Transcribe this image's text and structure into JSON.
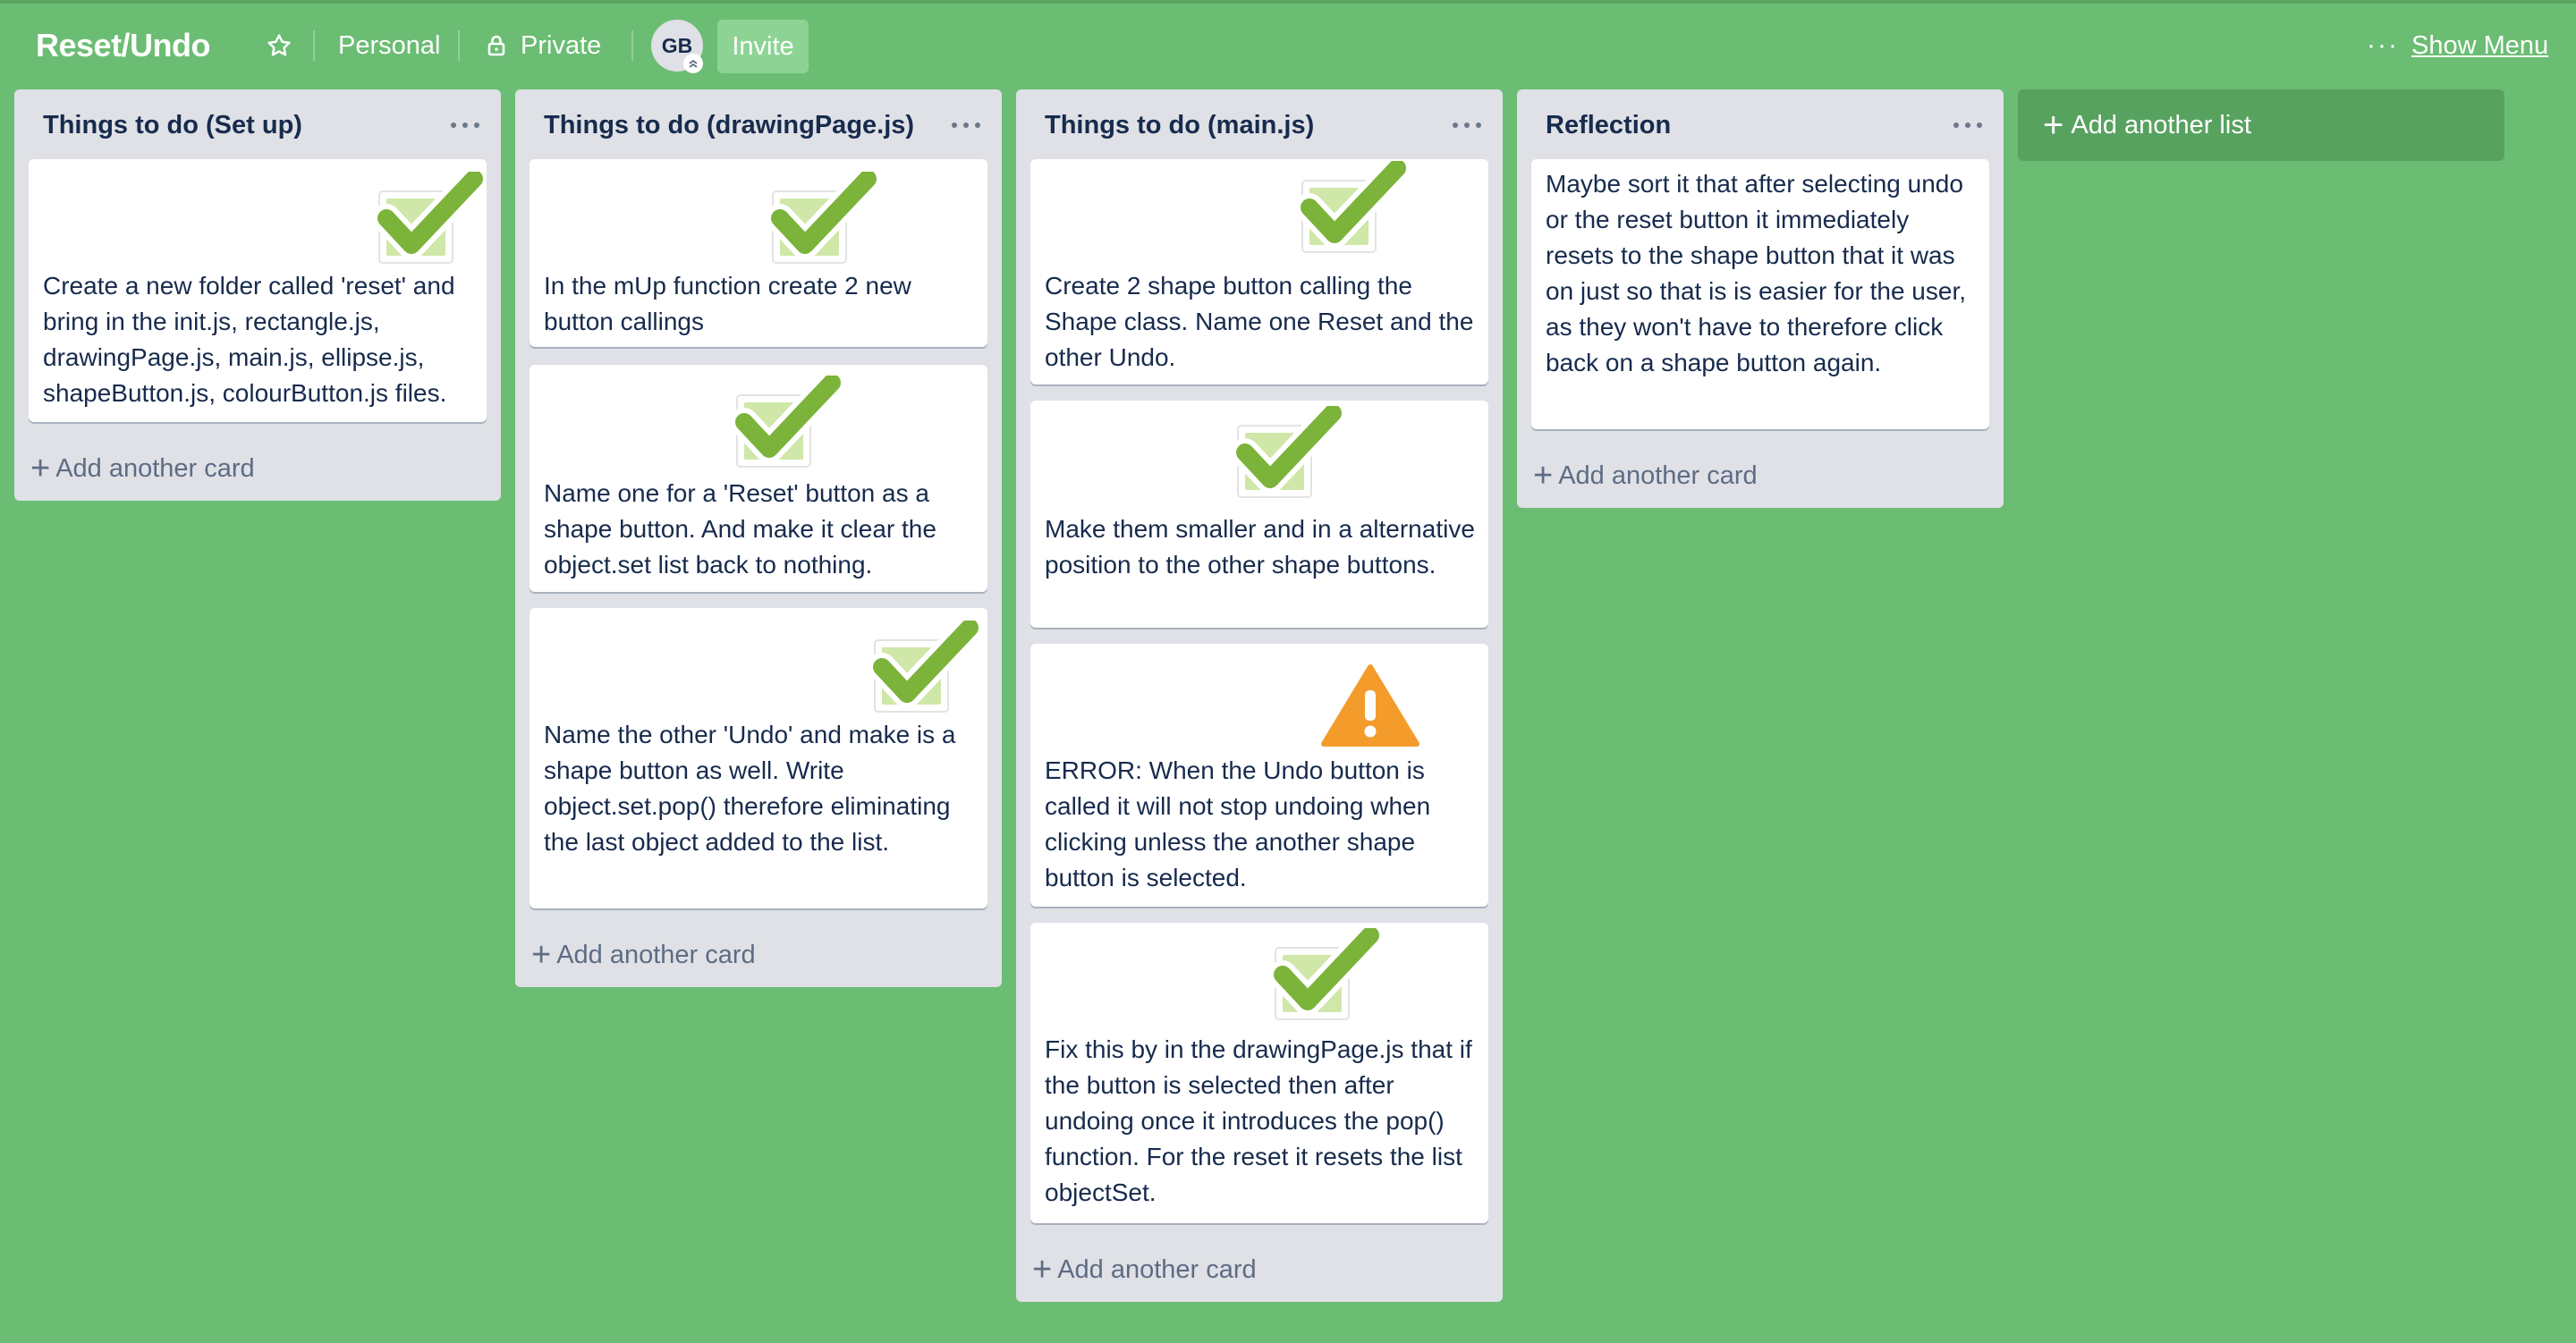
{
  "header": {
    "board_title": "Reset/Undo",
    "personal_label": "Personal",
    "private_label": "Private",
    "avatar_initials": "GB",
    "invite_label": "Invite",
    "show_menu_label": "Show Menu",
    "menu_icon": "ellipsis-icon"
  },
  "colors": {
    "board_background": "#6bbd73",
    "list_background": "#dfe1e6",
    "card_background": "#ffffff",
    "check_green": "#7cb33a",
    "warning_orange": "#f39c2c",
    "text_dark": "#172b4d"
  },
  "add_card_label": "Add another card",
  "add_list_label": "Add another list",
  "lists": [
    {
      "title": "Things to do (Set up)",
      "cards": [
        {
          "icon": "checkmark-icon",
          "text": "Create a new folder called 'reset' and bring in the init.js, rectangle.js, drawingPage.js, main.js, ellipse.js, shapeButton.js, colourButton.js files."
        }
      ]
    },
    {
      "title": "Things to do (drawingPage.js)",
      "cards": [
        {
          "icon": "checkmark-icon",
          "text": "In the mUp function create 2 new button callings"
        },
        {
          "icon": "checkmark-icon",
          "text": "Name one for a 'Reset' button as a shape button. And make it clear the object.set list back to nothing."
        },
        {
          "icon": "checkmark-icon",
          "text": "Name the other 'Undo' and make is a shape button as well. Write object.set.pop() therefore eliminating the last object added to the list."
        }
      ]
    },
    {
      "title": "Things to do (main.js)",
      "cards": [
        {
          "icon": "checkmark-icon",
          "text": "Create 2 shape button calling the Shape class. Name one Reset and the other Undo."
        },
        {
          "icon": "checkmark-icon",
          "text": "Make them smaller and in a alternative position to the other shape buttons."
        },
        {
          "icon": "warning-icon",
          "text": "ERROR: When the Undo button is called it will not stop undoing when clicking unless the another shape button is selected."
        },
        {
          "icon": "checkmark-icon",
          "text": "Fix this by in the drawingPage.js that if the button is selected then after undoing once it introduces the pop() function. For the reset it resets the list objectSet."
        }
      ]
    },
    {
      "title": "Reflection",
      "cards": [
        {
          "icon": "",
          "text": "Maybe sort it that after selecting undo or the reset button it immediately resets to the shape button that it was on just so that is is easier for the user, as they won't have to therefore click back on a shape button again."
        }
      ]
    }
  ]
}
